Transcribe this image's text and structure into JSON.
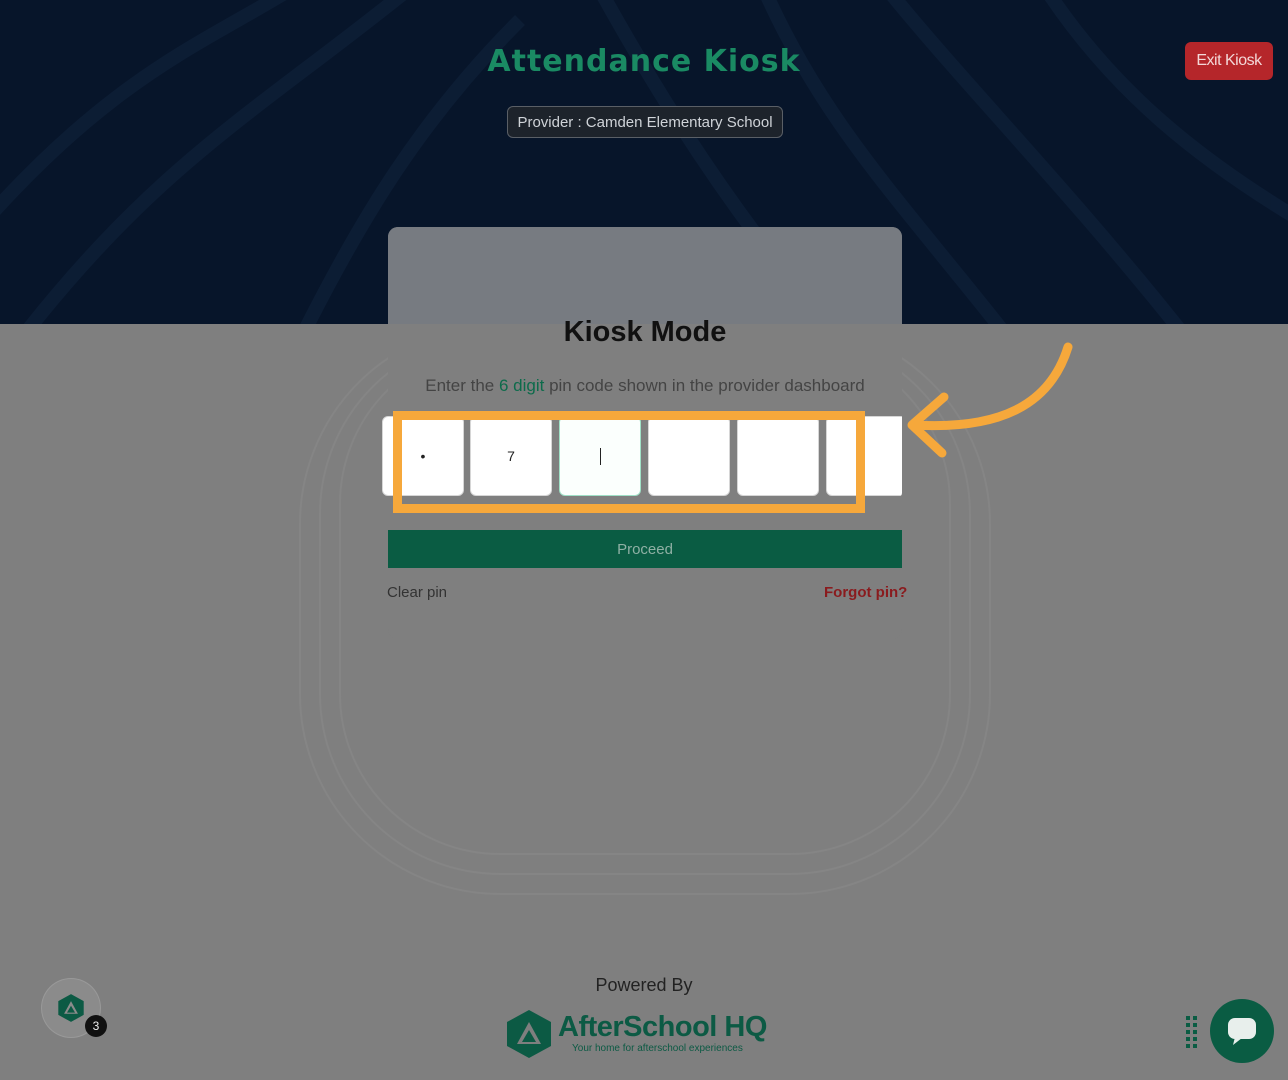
{
  "header": {
    "title": "Attendance Kiosk",
    "provider_label": "Provider : Camden Elementary School",
    "exit_label": "Exit Kiosk"
  },
  "card": {
    "title": "Kiosk Mode",
    "instruction_prefix": "Enter the ",
    "instruction_highlight": "6 digit",
    "instruction_suffix": " pin code shown in the provider dashboard",
    "pin_digits": [
      "•",
      "7",
      "",
      "",
      "",
      ""
    ],
    "proceed_label": "Proceed",
    "clear_label": "Clear pin",
    "forgot_label": "Forgot pin?"
  },
  "footer": {
    "powered_by": "Powered By",
    "brand_name": "AfterSchool HQ",
    "brand_tagline": "Your home for afterschool experiences"
  },
  "widgets": {
    "notification_count": "3"
  },
  "colors": {
    "brand_green": "#0a5c43",
    "title_green": "#1a8a63",
    "exit_red": "#b5262a",
    "annotation_orange": "#f6a83b"
  }
}
